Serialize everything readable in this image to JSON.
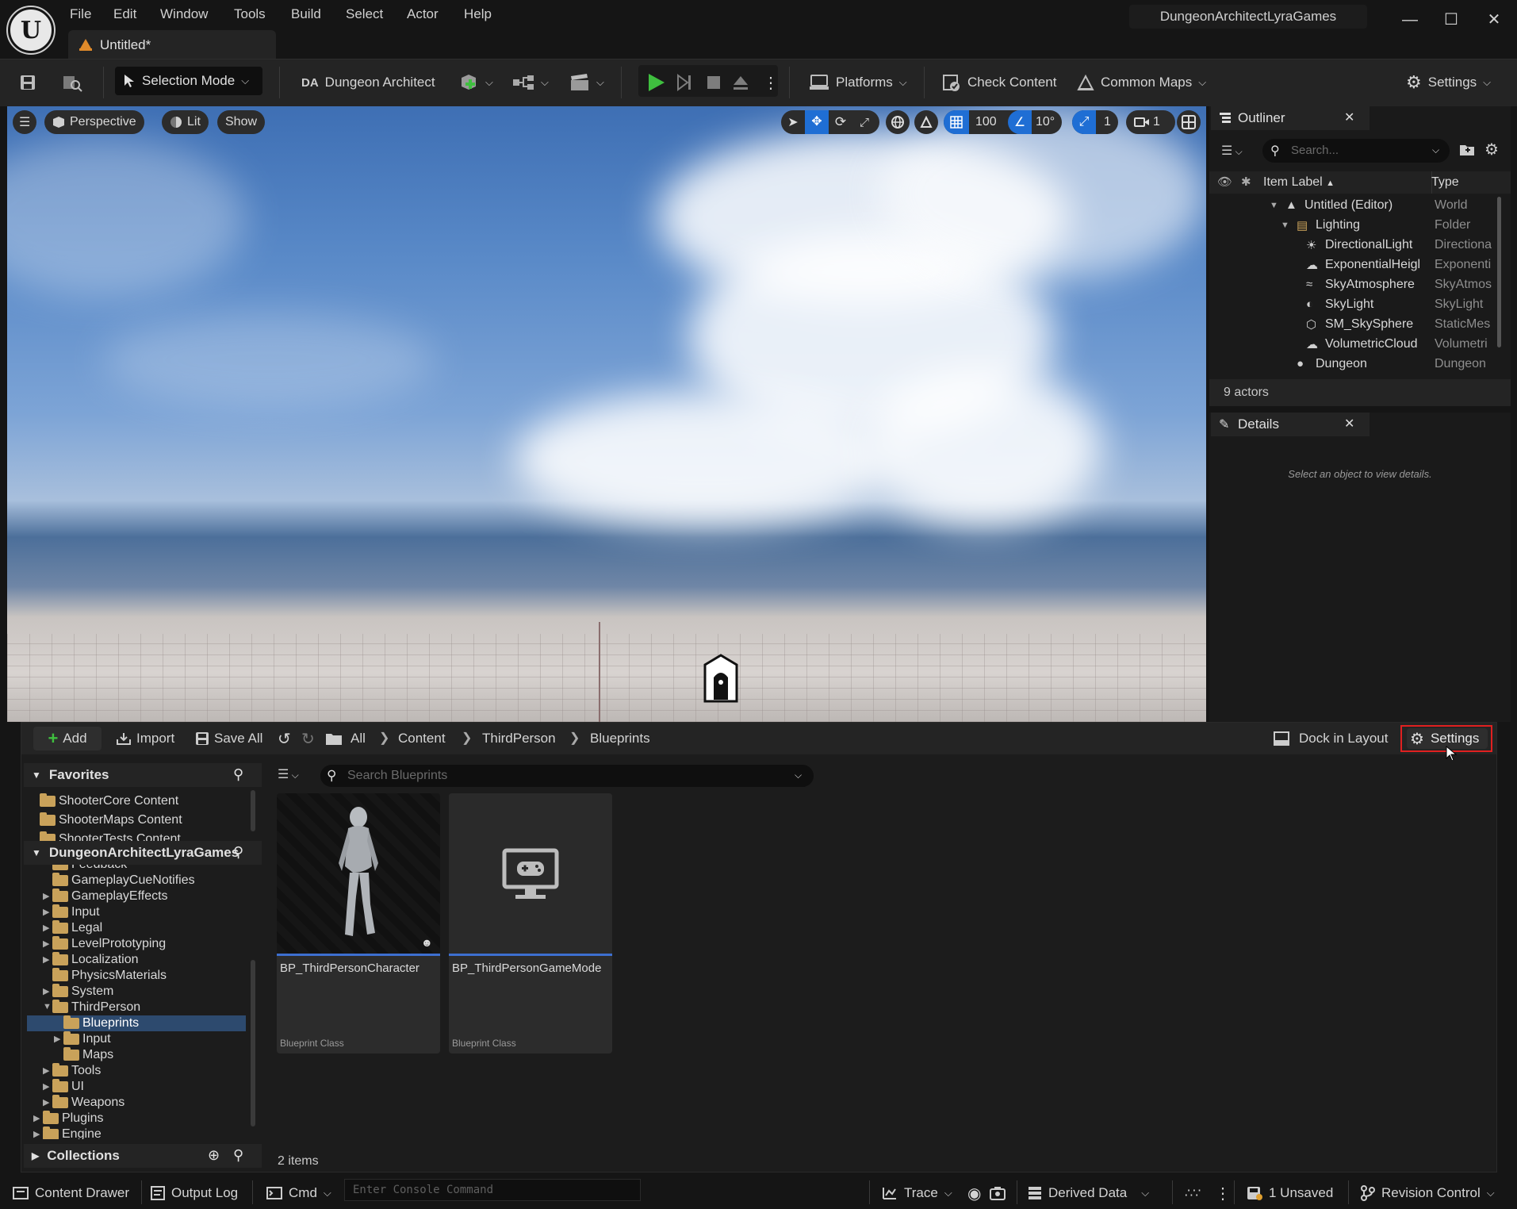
{
  "titlebar": {
    "menu": [
      "File",
      "Edit",
      "Window",
      "Tools",
      "Build",
      "Select",
      "Actor",
      "Help"
    ],
    "tab_label": "Untitled*",
    "project_name": "DungeonArchitectLyraGames"
  },
  "toolbar": {
    "selection_mode": "Selection Mode",
    "dungeon_architect": "Dungeon Architect",
    "platforms": "Platforms",
    "check_content": "Check Content",
    "common_maps": "Common Maps",
    "settings": "Settings"
  },
  "viewport": {
    "perspective": "Perspective",
    "lit": "Lit",
    "show": "Show",
    "grid_snap": "100",
    "rotation_snap": "10°",
    "scale_snap": "1",
    "camera_speed": "1"
  },
  "outliner": {
    "title": "Outliner",
    "search_placeholder": "Search...",
    "col_label": "Item Label",
    "col_type": "Type",
    "rows": [
      {
        "label": "Untitled (Editor)",
        "type": "World",
        "icon": "world-icon"
      },
      {
        "label": "Lighting",
        "type": "Folder",
        "icon": "folder-icon"
      },
      {
        "label": "DirectionalLight",
        "type": "Directiona",
        "icon": "sun-icon"
      },
      {
        "label": "ExponentialHeigl",
        "type": "Exponenti",
        "icon": "fog-icon"
      },
      {
        "label": "SkyAtmosphere",
        "type": "SkyAtmos",
        "icon": "sky-atmosphere-icon"
      },
      {
        "label": "SkyLight",
        "type": "SkyLight",
        "icon": "skylight-icon"
      },
      {
        "label": "SM_SkySphere",
        "type": "StaticMes",
        "icon": "mesh-icon"
      },
      {
        "label": "VolumetricCloud",
        "type": "Volumetri",
        "icon": "cloud-icon"
      },
      {
        "label": "Dungeon",
        "type": "Dungeon",
        "icon": "dungeon-icon"
      }
    ],
    "actor_count": "9 actors"
  },
  "details": {
    "title": "Details",
    "empty_message": "Select an object to view details."
  },
  "content_browser": {
    "add": "Add",
    "import": "Import",
    "save_all": "Save All",
    "breadcrumbs": [
      "All",
      "Content",
      "ThirdPerson",
      "Blueprints"
    ],
    "dock_in_layout": "Dock in Layout",
    "settings": "Settings",
    "favorites_title": "Favorites",
    "favorites": [
      "ShooterCore Content",
      "ShooterMaps Content",
      "ShooterTests Content"
    ],
    "project_title": "DungeonArchitectLyraGames",
    "tree": [
      {
        "label": "Feedback",
        "depth": 1,
        "arrow": false
      },
      {
        "label": "GameplayCueNotifies",
        "depth": 1,
        "arrow": false
      },
      {
        "label": "GameplayEffects",
        "depth": 1,
        "arrow": true
      },
      {
        "label": "Input",
        "depth": 1,
        "arrow": true
      },
      {
        "label": "Legal",
        "depth": 1,
        "arrow": true
      },
      {
        "label": "LevelPrototyping",
        "depth": 1,
        "arrow": true
      },
      {
        "label": "Localization",
        "depth": 1,
        "arrow": true
      },
      {
        "label": "PhysicsMaterials",
        "depth": 1,
        "arrow": false
      },
      {
        "label": "System",
        "depth": 1,
        "arrow": true
      },
      {
        "label": "ThirdPerson",
        "depth": 1,
        "arrow": "open"
      },
      {
        "label": "Blueprints",
        "depth": 2,
        "arrow": false,
        "selected": true
      },
      {
        "label": "Input",
        "depth": 2,
        "arrow": true
      },
      {
        "label": "Maps",
        "depth": 2,
        "arrow": false
      },
      {
        "label": "Tools",
        "depth": 1,
        "arrow": true
      },
      {
        "label": "UI",
        "depth": 1,
        "arrow": true
      },
      {
        "label": "Weapons",
        "depth": 1,
        "arrow": true
      },
      {
        "label": "Plugins",
        "depth": 0,
        "arrow": true
      },
      {
        "label": "Engine",
        "depth": 0,
        "arrow": true
      }
    ],
    "collections_title": "Collections",
    "search_placeholder": "Search Blueprints",
    "assets": [
      {
        "name": "BP_ThirdPersonCharacter",
        "type": "Blueprint Class"
      },
      {
        "name": "BP_ThirdPersonGameMode",
        "type": "Blueprint Class"
      }
    ],
    "item_count": "2 items"
  },
  "statusbar": {
    "content_drawer": "Content Drawer",
    "output_log": "Output Log",
    "cmd": "Cmd",
    "console_placeholder": "Enter Console Command",
    "trace": "Trace",
    "derived_data": "Derived Data",
    "unsaved": "1 Unsaved",
    "revision_control": "Revision Control"
  }
}
